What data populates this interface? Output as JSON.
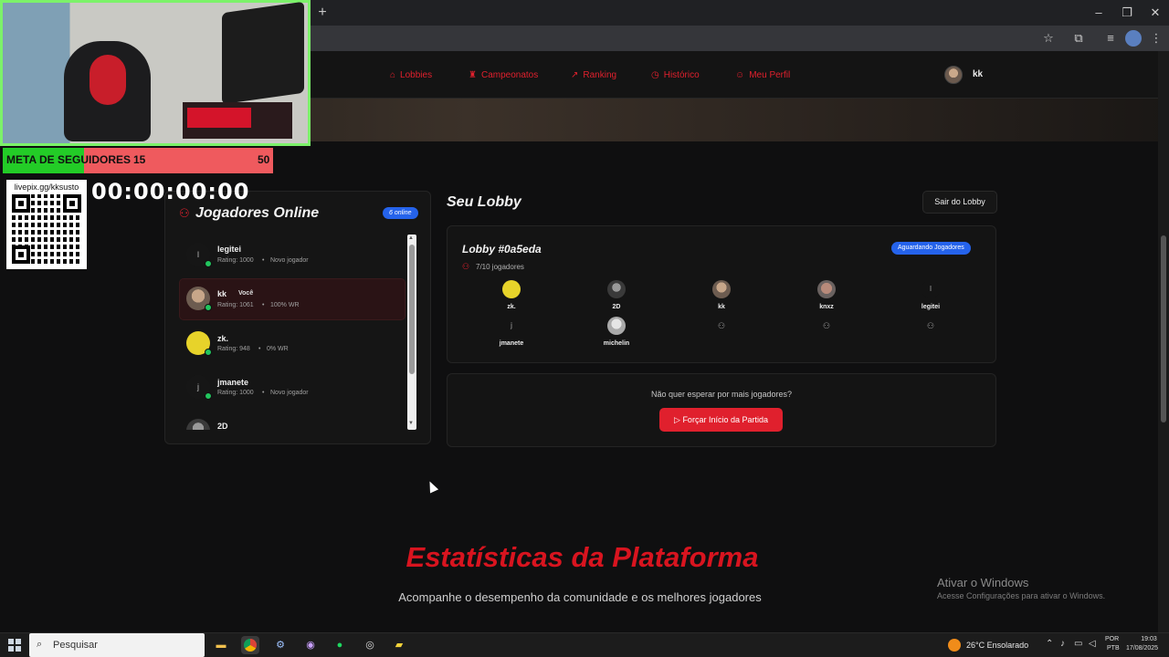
{
  "browser": {
    "new_tab": "+",
    "win_min": "–",
    "win_max": "❐",
    "win_close": "✕"
  },
  "nav": {
    "items": [
      {
        "icon": "⌂",
        "label": "Lobbies"
      },
      {
        "icon": "♜",
        "label": "Campeonatos"
      },
      {
        "icon": "↗",
        "label": "Ranking"
      },
      {
        "icon": "◷",
        "label": "Histórico"
      },
      {
        "icon": "☺",
        "label": "Meu Perfil"
      }
    ],
    "user": "kk"
  },
  "online": {
    "title": "Jogadores Online",
    "badge": "6 online",
    "players": [
      {
        "name": "legitei",
        "avatar_letter": "l",
        "rating": "Rating: 1000",
        "detail": "Novo jogador",
        "you": ""
      },
      {
        "name": "kk",
        "avatar_letter": "",
        "rating": "Rating: 1061",
        "detail": "100% WR",
        "you": "Você"
      },
      {
        "name": "zk.",
        "avatar_letter": "",
        "rating": "Rating: 948",
        "detail": "0% WR",
        "you": ""
      },
      {
        "name": "jmanete",
        "avatar_letter": "j",
        "rating": "Rating: 1000",
        "detail": "Novo jogador",
        "you": ""
      },
      {
        "name": "2D",
        "avatar_letter": "",
        "rating": "",
        "detail": "",
        "you": ""
      }
    ],
    "separator": "•"
  },
  "lobby": {
    "heading": "Seu Lobby",
    "leave": "Sair do Lobby",
    "id": "Lobby #0a5eda",
    "status": "Aguardando Jogadores",
    "count": "7/10 jogadores",
    "slots": [
      {
        "name": "zk.",
        "letter": ""
      },
      {
        "name": "2D",
        "letter": ""
      },
      {
        "name": "kk",
        "letter": ""
      },
      {
        "name": "knxz",
        "letter": ""
      },
      {
        "name": "legitei",
        "letter": "l"
      },
      {
        "name": "jmanete",
        "letter": "j"
      },
      {
        "name": "michelin",
        "letter": ""
      }
    ],
    "empty_icon": "⚇",
    "force_question": "Não quer esperar por mais jogadores?",
    "force_button": "Forçar Início da Partida",
    "force_icon": "▷"
  },
  "stats": {
    "title": "Estatísticas da Plataforma",
    "subtitle": "Acompanhe o desempenho da comunidade e os melhores jogadores"
  },
  "watermark": {
    "line1": "Ativar o Windows",
    "line2": "Acesse Configurações para ativar o Windows."
  },
  "overlay": {
    "goal_label": "META DE SEGUIDORES",
    "goal_current": "15",
    "goal_max": "50",
    "goal_progress": 0.3,
    "qr_url": "livepix.gg/kksusto",
    "timer": "00:00:00:00"
  },
  "taskbar": {
    "search": "Pesquisar",
    "weather": "26°C  Ensolarado",
    "lang1": "POR",
    "lang2": "PTB",
    "time": "19:03",
    "date": "17/08/2025"
  },
  "colors": {
    "accent": "#e0202d",
    "badge_blue": "#2563eb",
    "online_green": "#22c55e"
  }
}
